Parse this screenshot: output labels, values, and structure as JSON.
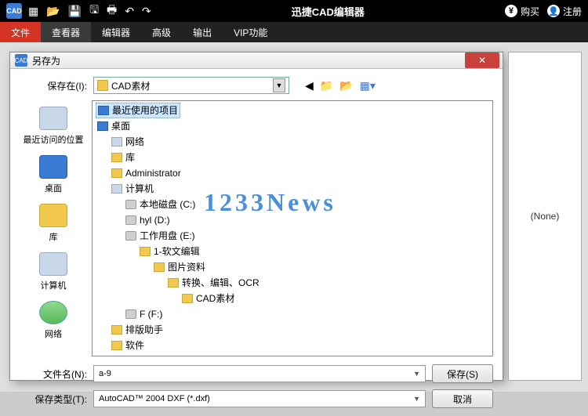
{
  "titlebar": {
    "app_logo": "CAD",
    "title": "迅捷CAD编辑器",
    "buy": "购买",
    "register": "注册",
    "currency": "¥"
  },
  "menu": {
    "file": "文件",
    "viewer": "查看器",
    "editor": "编辑器",
    "advanced": "高级",
    "output": "输出",
    "vip": "VIP功能"
  },
  "dialog": {
    "title": "另存为",
    "save_in_label": "保存在(I):",
    "save_in_value": "CAD素材",
    "filename_label": "文件名(N):",
    "filename_value": "a-9",
    "filetype_label": "保存类型(T):",
    "filetype_value": "AutoCAD™ 2004 DXF (*.dxf)",
    "save_btn": "保存(S)",
    "cancel_btn": "取消"
  },
  "places": {
    "recent": "最近访问的位置",
    "desktop": "桌面",
    "library": "库",
    "computer": "计算机",
    "network": "网络"
  },
  "tree": {
    "recent": "最近使用的项目",
    "desktop": "桌面",
    "network": "网络",
    "library": "库",
    "admin": "Administrator",
    "computer": "计算机",
    "drive_c": "本地磁盘 (C:)",
    "drive_d": "hyl (D:)",
    "drive_e": "工作用盘 (E:)",
    "folder_1": "1-软文编辑",
    "folder_pics": "图片资料",
    "folder_ocr": "转换、编辑、OCR",
    "folder_cad": "CAD素材",
    "drive_f": "F (F:)",
    "folder_layout": "排版助手",
    "folder_soft": "软件"
  },
  "sidepanel": {
    "none": "(None)"
  },
  "watermark": "1233News"
}
